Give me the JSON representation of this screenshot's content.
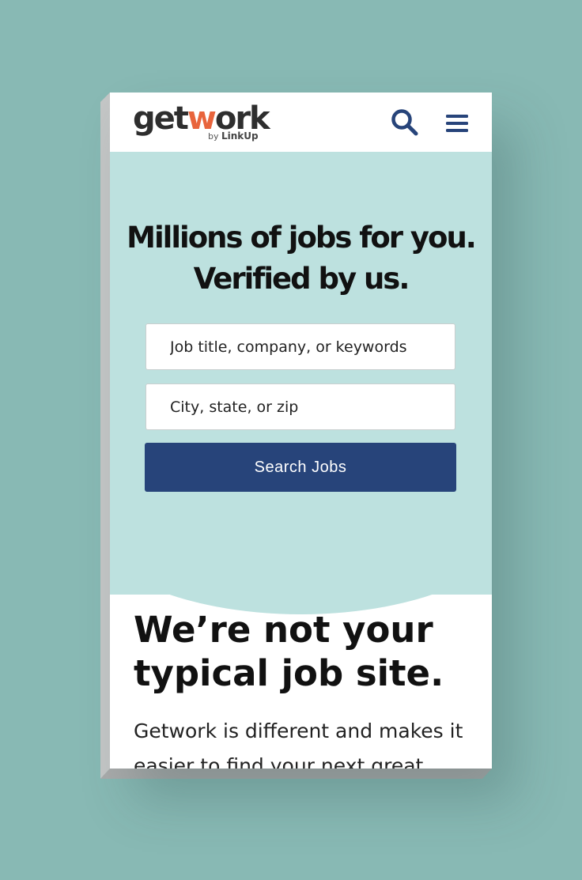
{
  "header": {
    "logo_part1": "getw",
    "logo_part2": "ork",
    "logo_mark": "/",
    "logo_by": "by",
    "logo_brand": "LinkUp",
    "search_icon": "search-icon",
    "menu_icon": "hamburger-menu-icon"
  },
  "hero": {
    "headline_line1": "Millions of jobs for you.",
    "headline_line2": "Verified by us.",
    "keywords_placeholder": "Job title, company, or keywords",
    "location_placeholder": "City, state, or zip",
    "search_button": "Search Jobs"
  },
  "section": {
    "title": "We’re not your typical job site.",
    "text": "Getwork is different and makes it easier to find your next great"
  },
  "colors": {
    "background": "#88b9b4",
    "hero": "#bde1df",
    "brand_blue": "#27447a",
    "logo_accent": "#e8643c"
  }
}
